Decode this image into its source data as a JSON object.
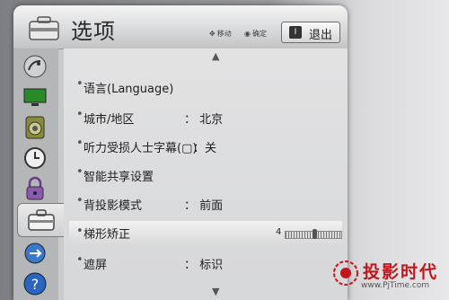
{
  "header": {
    "title": "选项",
    "hint_move": "移动",
    "hint_confirm": "确定",
    "exit_label": "退出",
    "exit_key": "I"
  },
  "sidebar": {
    "items": [
      {
        "icon": "satellite-dish-icon"
      },
      {
        "icon": "monitor-icon"
      },
      {
        "icon": "speaker-icon"
      },
      {
        "icon": "clock-icon"
      },
      {
        "icon": "lock-icon"
      },
      {
        "icon": "toolbox-icon",
        "active": true
      },
      {
        "icon": "usb-icon"
      },
      {
        "icon": "help-icon"
      }
    ]
  },
  "menu": {
    "rows": [
      {
        "label": "语言(Language)",
        "value": ""
      },
      {
        "label": "城市/地区",
        "value": "：  北京"
      },
      {
        "label": "听力受损人士字幕(▢)",
        "value": "：关"
      },
      {
        "label": "智能共享设置",
        "value": ""
      },
      {
        "label": "背投影模式",
        "value": "：  前面"
      },
      {
        "label": "梯形矫正",
        "value": "",
        "slider_value": "4"
      },
      {
        "label": "遮屏",
        "value": "：  标识"
      }
    ]
  },
  "watermark": {
    "text": "投影时代",
    "url": "www.PjTime.com"
  },
  "colors": {
    "accent_red": "#c0161c"
  }
}
